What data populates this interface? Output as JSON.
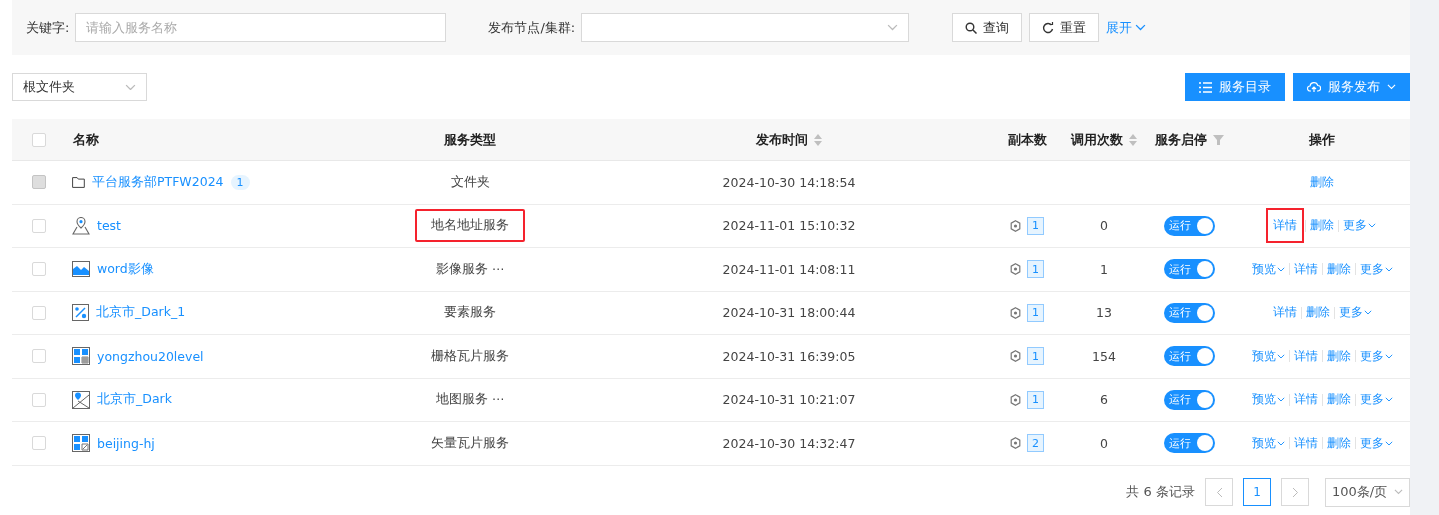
{
  "filters": {
    "keyword": {
      "label": "关键字:",
      "placeholder": "请输入服务名称"
    },
    "node": {
      "label": "发布节点/集群:"
    },
    "buttons": [
      {
        "label": "查询",
        "kind": "search"
      },
      {
        "label": "重置",
        "kind": "reset"
      }
    ],
    "expand": "展开"
  },
  "folder_select": "根文件夹",
  "toolbar": [
    {
      "label": "服务目录",
      "kind": "list"
    },
    {
      "label": "服务发布",
      "kind": "upload"
    }
  ],
  "table": {
    "select_all": {
      "checked": false
    },
    "columns": [
      {
        "label": "名称",
        "kind": "plain"
      },
      {
        "label": "服务类型",
        "kind": "plain"
      },
      {
        "label": "发布时间",
        "kind": "sortable"
      },
      {
        "label": "副本数",
        "kind": "plain"
      },
      {
        "label": "调用次数",
        "kind": "sortable"
      },
      {
        "label": "服务启停",
        "kind": "filterable"
      },
      {
        "label": "操作",
        "kind": "plain"
      }
    ],
    "rows": [
      {
        "kind": "folder",
        "checked": false,
        "disabled": true,
        "name": "平台服务部PTFW2024",
        "count": "1",
        "type": "文件夹",
        "type_highlighted": false,
        "time": "2024-10-30 14:18:54",
        "actions": [
          {
            "label": "删除",
            "kind": "link",
            "highlighted": false
          }
        ]
      },
      {
        "kind": "geocode",
        "checked": false,
        "disabled": false,
        "name": "test",
        "type": "地名地址服务",
        "type_highlighted": true,
        "time": "2024-11-01 15:10:32",
        "replicas": "1",
        "calls": "0",
        "switch": {
          "label": "运行",
          "on": true
        },
        "actions": [
          {
            "label": "详情",
            "kind": "link",
            "highlighted": true
          },
          {
            "label": "删除",
            "kind": "link",
            "highlighted": false
          },
          {
            "label": "更多",
            "kind": "dropdown",
            "highlighted": false
          }
        ]
      },
      {
        "kind": "image",
        "checked": false,
        "disabled": false,
        "name": "word影像",
        "type": "影像服务 ⋯",
        "type_highlighted": false,
        "time": "2024-11-01 14:08:11",
        "replicas": "1",
        "calls": "1",
        "switch": {
          "label": "运行",
          "on": true
        },
        "actions": [
          {
            "label": "预览",
            "kind": "dropdown",
            "highlighted": false
          },
          {
            "label": "详情",
            "kind": "link",
            "highlighted": false
          },
          {
            "label": "删除",
            "kind": "link",
            "highlighted": false
          },
          {
            "label": "更多",
            "kind": "dropdown",
            "highlighted": false
          }
        ]
      },
      {
        "kind": "feature",
        "checked": false,
        "disabled": false,
        "name": "北京市_Dark_1",
        "type": "要素服务",
        "type_highlighted": false,
        "time": "2024-10-31 18:00:44",
        "replicas": "1",
        "calls": "13",
        "switch": {
          "label": "运行",
          "on": true
        },
        "actions": [
          {
            "label": "详情",
            "kind": "link",
            "highlighted": false
          },
          {
            "label": "删除",
            "kind": "link",
            "highlighted": false
          },
          {
            "label": "更多",
            "kind": "dropdown",
            "highlighted": false
          }
        ]
      },
      {
        "kind": "grid-tile",
        "checked": false,
        "disabled": false,
        "name": "yongzhou20level",
        "type": "栅格瓦片服务",
        "type_highlighted": false,
        "time": "2024-10-31 16:39:05",
        "replicas": "1",
        "calls": "154",
        "switch": {
          "label": "运行",
          "on": true
        },
        "actions": [
          {
            "label": "预览",
            "kind": "dropdown",
            "highlighted": false
          },
          {
            "label": "详情",
            "kind": "link",
            "highlighted": false
          },
          {
            "label": "删除",
            "kind": "link",
            "highlighted": false
          },
          {
            "label": "更多",
            "kind": "dropdown",
            "highlighted": false
          }
        ]
      },
      {
        "kind": "map",
        "checked": false,
        "disabled": false,
        "name": "北京市_Dark",
        "type": "地图服务 ⋯",
        "type_highlighted": false,
        "time": "2024-10-31 10:21:07",
        "replicas": "1",
        "calls": "6",
        "switch": {
          "label": "运行",
          "on": true
        },
        "actions": [
          {
            "label": "预览",
            "kind": "dropdown",
            "highlighted": false
          },
          {
            "label": "详情",
            "kind": "link",
            "highlighted": false
          },
          {
            "label": "删除",
            "kind": "link",
            "highlighted": false
          },
          {
            "label": "更多",
            "kind": "dropdown",
            "highlighted": false
          }
        ]
      },
      {
        "kind": "vector-tile",
        "checked": false,
        "disabled": false,
        "name": "beijing-hj",
        "type": "矢量瓦片服务",
        "type_highlighted": false,
        "time": "2024-10-30 14:32:47",
        "replicas": "2",
        "calls": "0",
        "switch": {
          "label": "运行",
          "on": true
        },
        "actions": [
          {
            "label": "预览",
            "kind": "dropdown",
            "highlighted": false
          },
          {
            "label": "详情",
            "kind": "link",
            "highlighted": false
          },
          {
            "label": "删除",
            "kind": "link",
            "highlighted": false
          },
          {
            "label": "更多",
            "kind": "dropdown",
            "highlighted": false
          }
        ]
      }
    ]
  },
  "pagination": {
    "total": "共 6 条记录",
    "pages": [
      {
        "label": "1",
        "selected": true
      }
    ],
    "page_size": "100条/页"
  }
}
